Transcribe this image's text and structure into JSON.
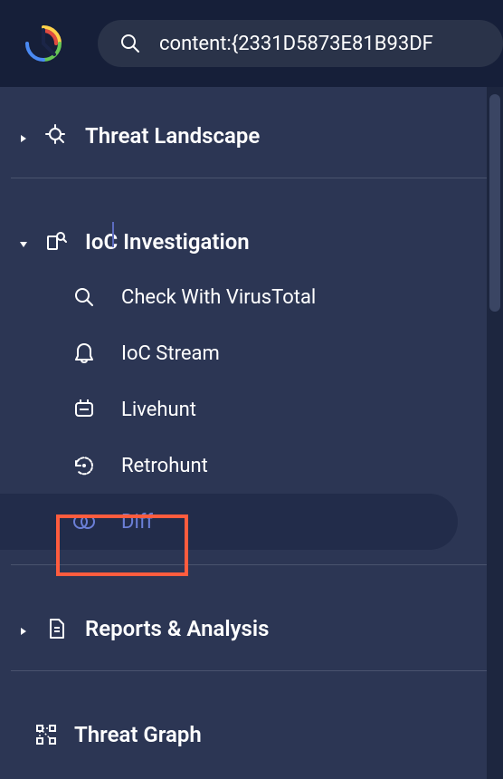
{
  "search": {
    "value": "content:{2331D5873E81B93DF"
  },
  "sections": {
    "threat_landscape": {
      "label": "Threat Landscape",
      "expanded": false
    },
    "ioc_investigation": {
      "label": "IoC Investigation",
      "expanded": true,
      "items": [
        {
          "label": "Check With VirusTotal"
        },
        {
          "label": "IoC Stream"
        },
        {
          "label": "Livehunt"
        },
        {
          "label": "Retrohunt"
        },
        {
          "label": "Diff"
        }
      ]
    },
    "reports_analysis": {
      "label": "Reports & Analysis",
      "expanded": false
    },
    "threat_graph": {
      "label": "Threat Graph"
    }
  }
}
